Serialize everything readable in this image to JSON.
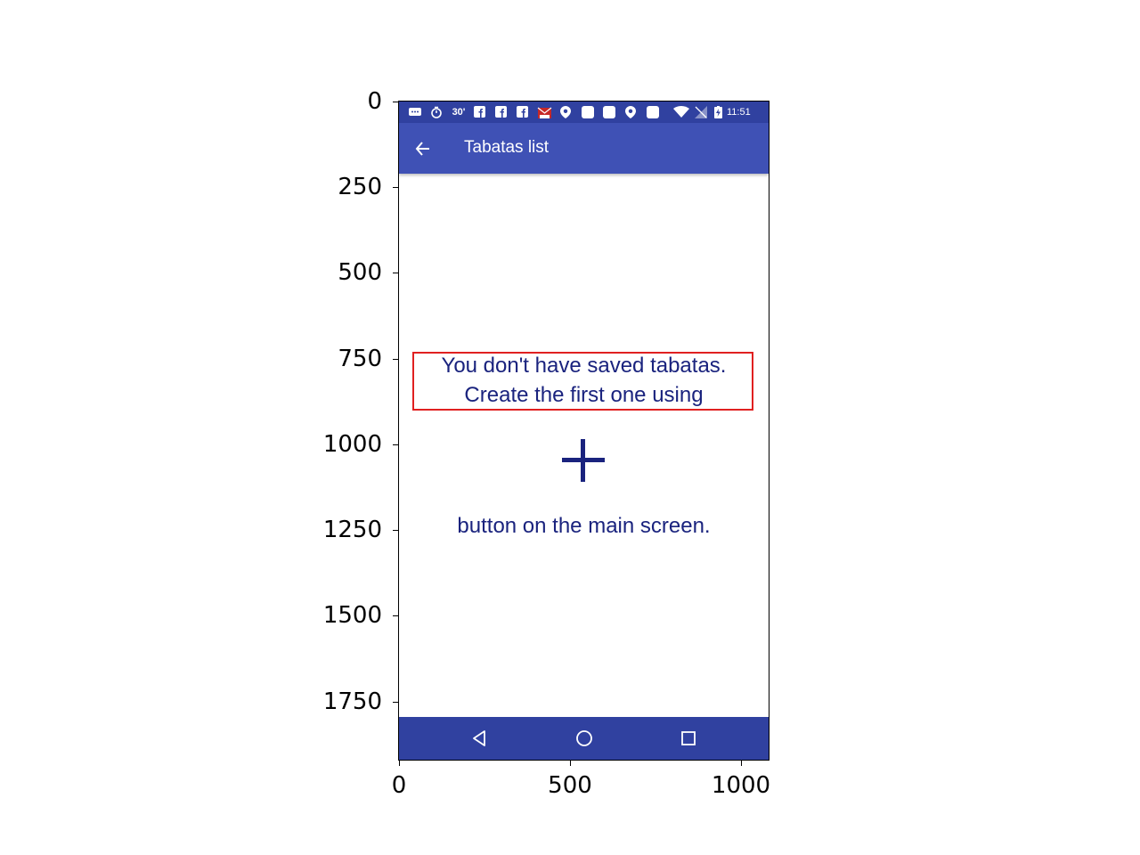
{
  "app": {
    "status_bar": {
      "time": "11:51",
      "timer_label": "30'",
      "icons": [
        "chat-icon",
        "stopwatch-icon",
        "facebook-icon",
        "facebook-icon",
        "facebook-icon",
        "pdf-app-icon",
        "location-icon",
        "app-icon",
        "app-icon",
        "location-icon",
        "app-icon",
        "wifi-icon",
        "no-signal-icon",
        "battery-charging-icon"
      ]
    },
    "toolbar": {
      "title": "Tabatas list",
      "back_icon": "arrow-back-icon"
    },
    "empty_state": {
      "line1": "You don't have saved tabatas.",
      "line2": "Create the first one using",
      "plus_icon": "plus-icon",
      "line3": "button on the main screen."
    },
    "nav_bar": {
      "icons": [
        "back-triangle-icon",
        "home-circle-icon",
        "recents-square-icon"
      ]
    }
  },
  "axes": {
    "y_ticks": [
      "0",
      "250",
      "500",
      "750",
      "1000",
      "1250",
      "1500",
      "1750"
    ],
    "x_ticks": [
      "0",
      "500",
      "1000"
    ]
  },
  "colors": {
    "toolbar": "#3f51b5",
    "status_bar": "#3041a0",
    "nav_bar": "#3041a0",
    "text": "#1a237e",
    "highlight": "#e02020"
  }
}
